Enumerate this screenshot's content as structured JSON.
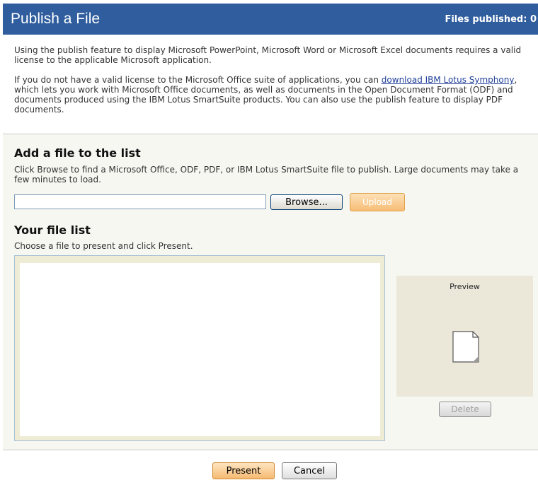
{
  "header": {
    "title": "Publish a File",
    "files_published": "Files published: 0"
  },
  "intro": {
    "paragraph1": "Using the publish feature to display Microsoft PowerPoint, Microsoft Word or Microsoft Excel documents requires a valid license to the applicable Microsoft application.",
    "paragraph2_before": "If you do not have a valid license to the Microsoft Office suite of applications, you can ",
    "paragraph2_link": "download IBM Lotus Symphony",
    "paragraph2_after": ", which lets you work with Microsoft Office documents, as well as documents in the Open Document Format (ODF) and documents produced using the IBM Lotus SmartSuite products. You can also use the publish feature to display PDF documents."
  },
  "add_file": {
    "heading": "Add a file to the list",
    "description": "Click Browse to find a Microsoft Office, ODF, PDF, or IBM Lotus SmartSuite file to publish. Large documents may take a few minutes to load.",
    "file_value": "",
    "browse_label": "Browse...",
    "upload_label": "Upload"
  },
  "file_list": {
    "heading": "Your file list",
    "description": "Choose a file to present and click Present.",
    "items": []
  },
  "preview": {
    "label": "Preview",
    "icon": "document-icon",
    "delete_label": "Delete"
  },
  "footer": {
    "present_label": "Present",
    "cancel_label": "Cancel"
  },
  "colors": {
    "header_bg": "#2f5d9e",
    "panel_bg": "#f7f7f2",
    "preview_bg": "#ebe8da",
    "accent_orange": "#f6ba72",
    "link": "#1f3f9a"
  }
}
